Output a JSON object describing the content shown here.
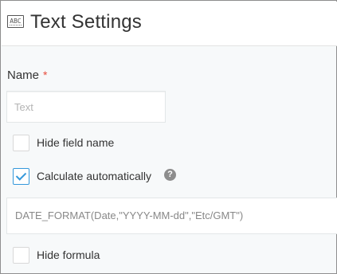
{
  "header": {
    "icon": "abc-text-field-icon",
    "icon_text": "ABC",
    "title": "Text Settings"
  },
  "name_field": {
    "label": "Name",
    "required_marker": "*",
    "value": "",
    "placeholder": "Text"
  },
  "options": {
    "hide_field_name": {
      "label": "Hide field name",
      "checked": false
    },
    "calculate_automatically": {
      "label": "Calculate automatically",
      "checked": true
    },
    "hide_formula": {
      "label": "Hide formula",
      "checked": false
    }
  },
  "help_icon": {
    "glyph": "?"
  },
  "formula": {
    "value": "DATE_FORMAT(Date,\"YYYY-MM-dd\",\"Etc/GMT\")"
  },
  "colors": {
    "accent": "#3498db",
    "required": "#e74c3c",
    "panel_bg": "#f7f9fa"
  }
}
